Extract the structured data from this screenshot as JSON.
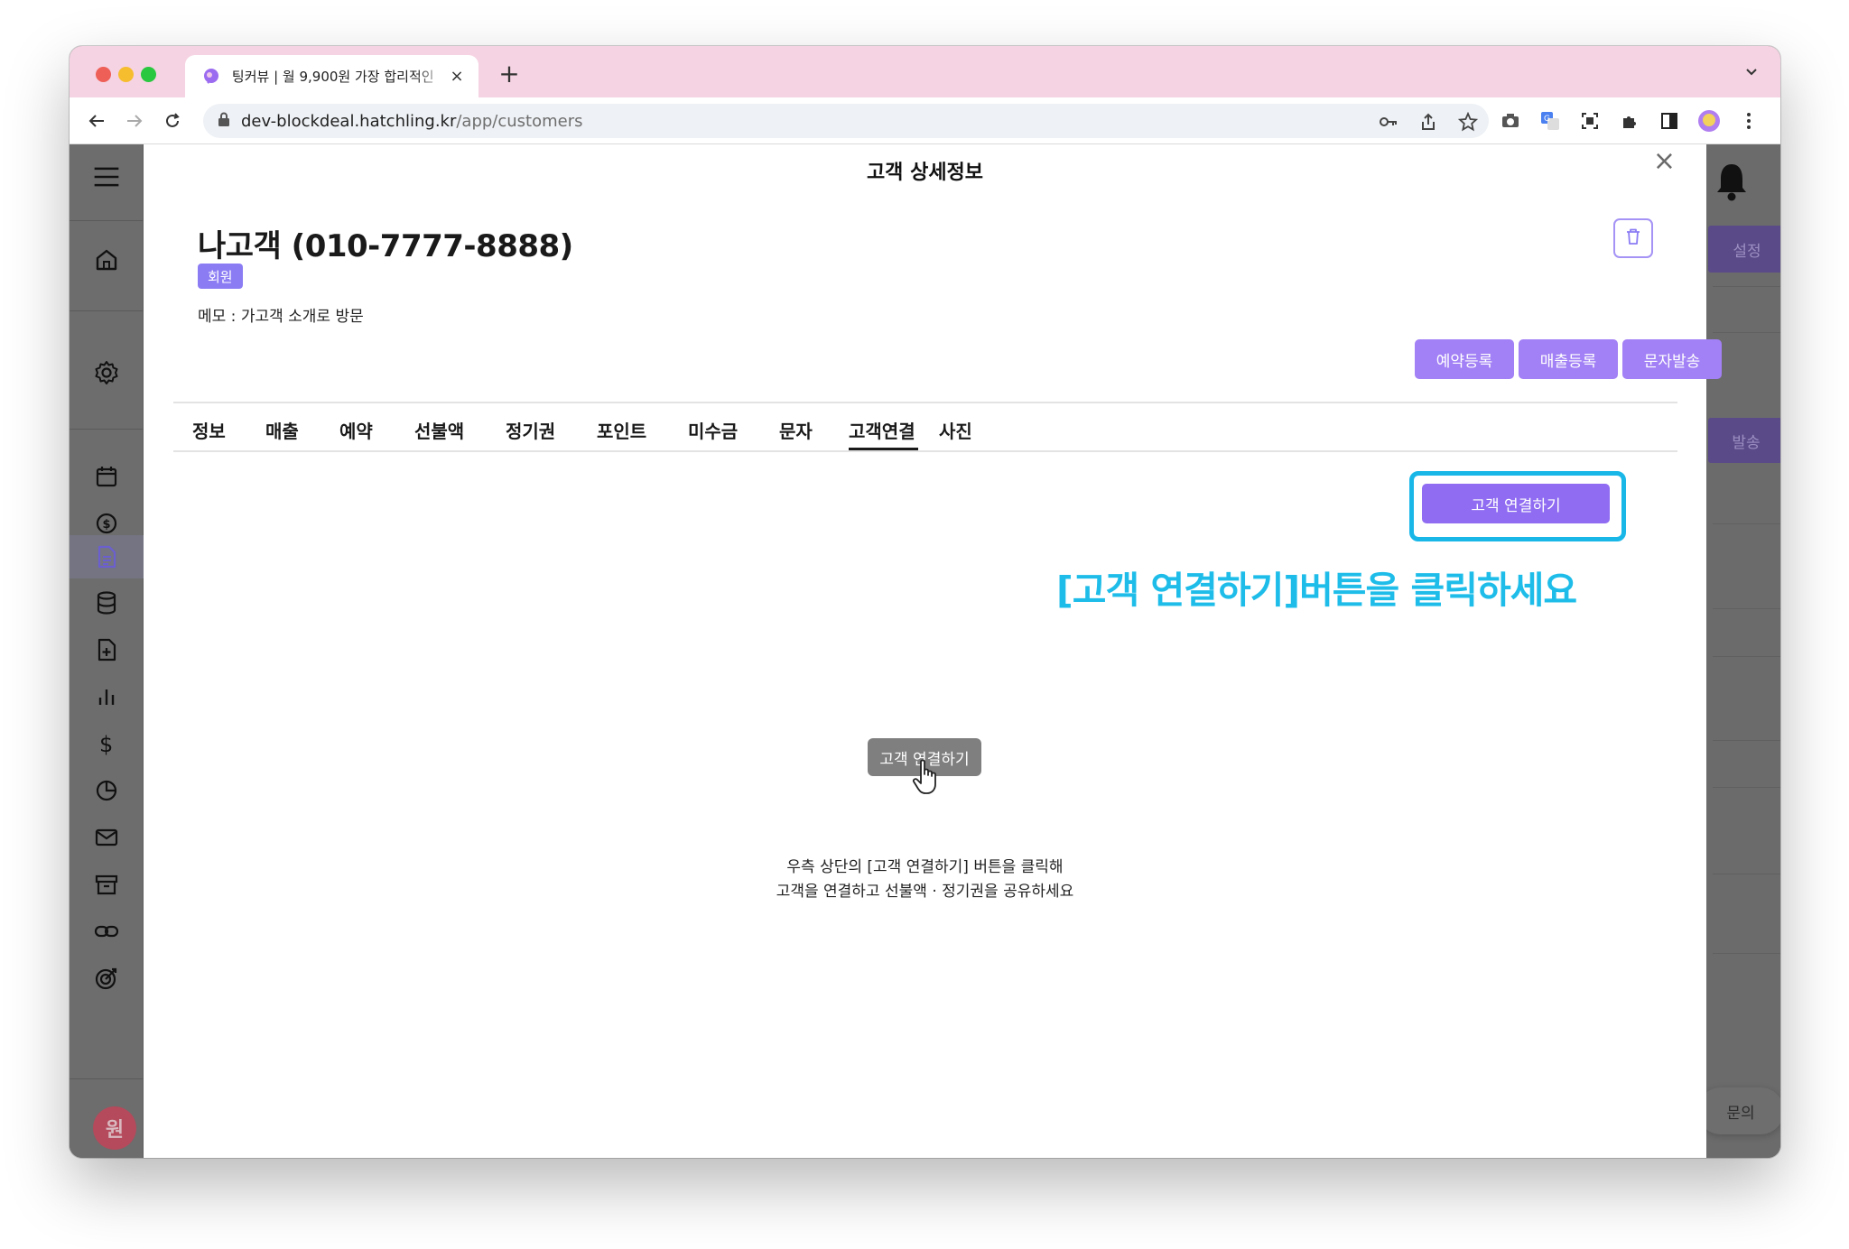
{
  "browser": {
    "tab_title": "팅커뷰 | 월 9,900원 가장 합리적인",
    "tab_close": "×",
    "new_tab": "+",
    "url_host": "dev-blockdeal.hatchling.kr",
    "url_path": "/app/customers"
  },
  "background": {
    "settings_label": "설정",
    "send_label": "발송",
    "inquiry_label": "문의",
    "avatar_initial": "원"
  },
  "modal": {
    "title": "고객 상세정보",
    "close": "×",
    "customer_name": "나고객 (010-7777-8888)",
    "badge": "회원",
    "memo": "메모 : 가고객 소개로 방문",
    "actions": {
      "reservation": "예약등록",
      "sales": "매출등록",
      "sms": "문자발송"
    },
    "tabs": [
      {
        "label": "정보"
      },
      {
        "label": "매출"
      },
      {
        "label": "예약"
      },
      {
        "label": "선불액"
      },
      {
        "label": "정기권"
      },
      {
        "label": "포인트"
      },
      {
        "label": "미수금"
      },
      {
        "label": "문자"
      },
      {
        "label": "고객연결"
      },
      {
        "label": "사진"
      }
    ],
    "active_tab": "고객연결",
    "connect_button": "고객 연결하기",
    "instruction": "[고객 연결하기]버튼을 클릭하세요",
    "empty_pill": "고객 연결하기",
    "empty_line1": "우측 상단의 [고객 연결하기] 버튼을 클릭해",
    "empty_line2": "고객을 연결하고 선불액 · 정기권을 공유하세요"
  },
  "colors": {
    "tabbar": "#f5d3e2",
    "accent": "#8f6cf1",
    "highlight": "#18b7e8"
  }
}
